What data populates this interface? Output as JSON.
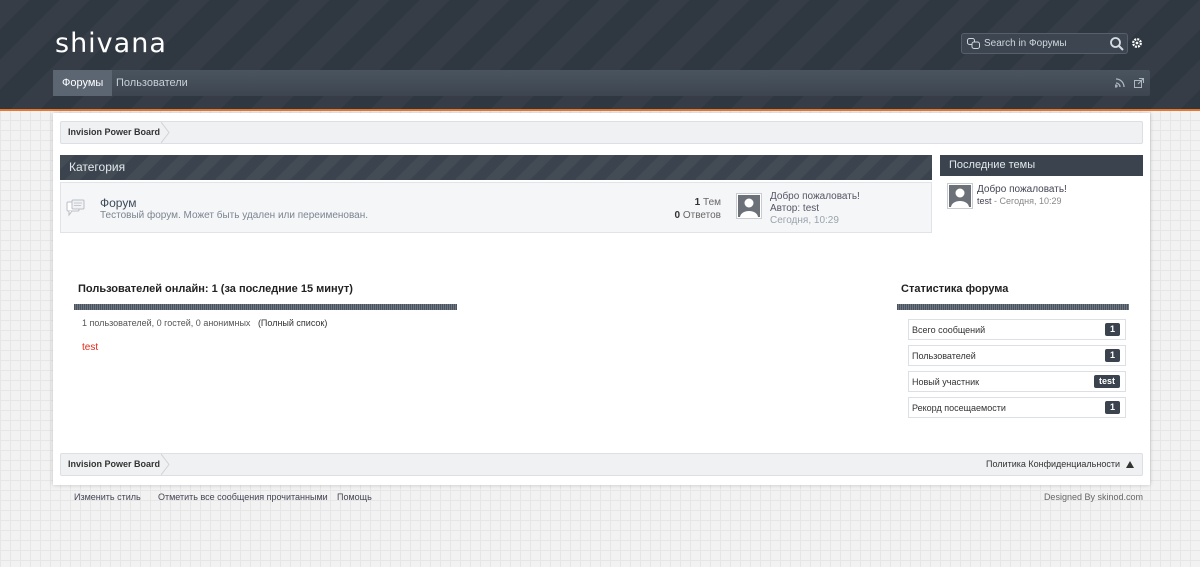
{
  "header": {
    "logo": "shivana",
    "search": {
      "placeholder": "Search in Форумы"
    }
  },
  "nav": {
    "tabs": [
      {
        "label": "Форумы",
        "active": true
      },
      {
        "label": "Пользователи",
        "active": false
      }
    ]
  },
  "breadcrumb": {
    "home": "Invision Power Board"
  },
  "category": {
    "title": "Категория",
    "forums": [
      {
        "title": "Форум",
        "description": "Тестовый форум. Может быть удален или переименован.",
        "topics_count": "1",
        "topics_label": "Тем",
        "replies_count": "0",
        "replies_label": "Ответов",
        "last_post": {
          "title": "Добро пожаловать!",
          "author_line": "Автор: test",
          "date": "Сегодня, 10:29"
        }
      }
    ]
  },
  "sidebar": {
    "title": "Последние темы",
    "items": [
      {
        "title": "Добро пожаловать!",
        "author": "test",
        "date": "- Сегодня, 10:29"
      }
    ]
  },
  "online": {
    "title": "Пользователей онлайн: 1 (за последние 15 минут)",
    "counts": "1 пользователей, 0 гостей, 0 анонимных",
    "full_list": "(Полный список)",
    "users": [
      "test"
    ]
  },
  "stats": {
    "title": "Статистика форума",
    "rows": [
      {
        "label": "Всего сообщений",
        "value": "1"
      },
      {
        "label": "Пользователей",
        "value": "1"
      },
      {
        "label": "Новый участник",
        "value": "test"
      },
      {
        "label": "Рекорд посещаемости",
        "value": "1"
      }
    ]
  },
  "footer_bar": {
    "home": "Invision Power Board",
    "privacy": "Политика Конфиденциальности"
  },
  "footer": {
    "links": [
      "Изменить стиль",
      "Отметить все сообщения прочитанными",
      "Помощь"
    ],
    "designed_by": "Designed By skinod.com"
  },
  "colors": {
    "header_bg": "#2f3741",
    "accent_line": "#e8762d",
    "dark_bar": "#3b444e",
    "online_user": "#e0291a"
  },
  "icons": {
    "search_scope": "scope-icon",
    "search_submit": "search-icon",
    "settings": "gear-icon",
    "rss": "rss-icon",
    "external": "external-link-icon",
    "forum": "forum-read-icon",
    "avatar": "avatar-icon",
    "scroll_top": "arrow-up-icon"
  }
}
